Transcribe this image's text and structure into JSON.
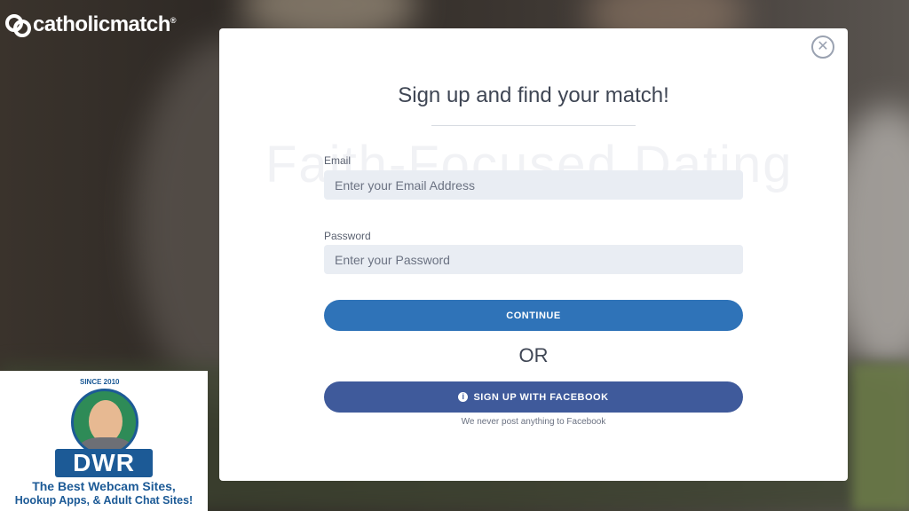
{
  "brand": {
    "name": "catholicmatch",
    "mark": "®"
  },
  "background": {
    "watermark": "Faith-Focused Dating"
  },
  "modal": {
    "title": "Sign up and find your match!",
    "email": {
      "label": "Email",
      "placeholder": "Enter your Email Address"
    },
    "password": {
      "label": "Password",
      "placeholder": "Enter your Password"
    },
    "continue_label": "CONTINUE",
    "or_text": "OR",
    "facebook_label": "SIGN UP WITH FACEBOOK",
    "facebook_note": "We never post anything to Facebook",
    "close_symbol": "✕"
  },
  "ad": {
    "since": "SINCE 2010",
    "logo": "DWR",
    "line1": "The Best Webcam Sites,",
    "line2": "Hookup Apps, & Adult Chat Sites!"
  },
  "colors": {
    "continue": "#2f73b8",
    "facebook": "#3f5a9b",
    "ad_blue": "#1c5a96"
  }
}
